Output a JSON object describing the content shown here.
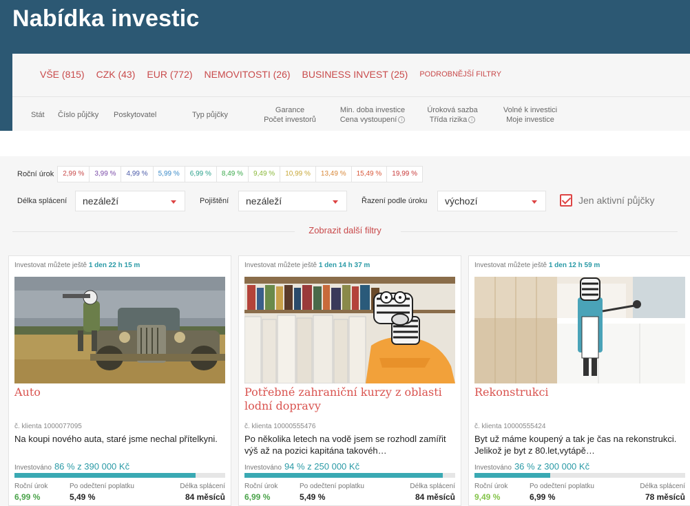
{
  "header": {
    "title": "Nabídka investic"
  },
  "tabs": [
    {
      "label": "VŠE (815)"
    },
    {
      "label": "CZK (43)"
    },
    {
      "label": "EUR (772)"
    },
    {
      "label": "NEMOVITOSTI (26)"
    },
    {
      "label": "BUSINESS INVEST (25)"
    },
    {
      "label": "PODROBNĚJŠÍ FILTRY"
    }
  ],
  "columns": {
    "stat": "Stát",
    "cislo": "Číslo půjčky",
    "poskytovatel": "Poskytovatel",
    "typ": "Typ půjčky",
    "garance": "Garance",
    "pocet": "Počet investorů",
    "min_doba": "Min. doba investice",
    "cena": "Cena vystoupení",
    "urokova": "Úroková sazba",
    "trida": "Třída rizika",
    "volne": "Volné k investici",
    "moje": "Moje investice"
  },
  "rates": {
    "label": "Roční úrok",
    "chips": [
      {
        "label": "2,99 %",
        "color": "#c84a4a"
      },
      {
        "label": "3,99 %",
        "color": "#7a4aa8"
      },
      {
        "label": "4,99 %",
        "color": "#4a5aa8"
      },
      {
        "label": "5,99 %",
        "color": "#3a8ac8"
      },
      {
        "label": "6,99 %",
        "color": "#2aa08a"
      },
      {
        "label": "8,49 %",
        "color": "#3aa84a"
      },
      {
        "label": "9,49 %",
        "color": "#8ab83a"
      },
      {
        "label": "10,99 %",
        "color": "#c8a83a"
      },
      {
        "label": "13,49 %",
        "color": "#d8883a"
      },
      {
        "label": "15,49 %",
        "color": "#d8583a"
      },
      {
        "label": "19,99 %",
        "color": "#c83a3a"
      }
    ]
  },
  "filters": {
    "delka_label": "Délka splácení",
    "delka_value": "nezáleží",
    "pojisteni_label": "Pojištění",
    "pojisteni_value": "nezáleží",
    "razeni_label": "Řazení podle úroku",
    "razeni_value": "výchozí",
    "aktivni_label": "Jen aktivní půjčky",
    "more": "Zobrazit další filtry"
  },
  "cards": [
    {
      "time_prefix": "Investovat můžete ještě",
      "time": "1 den 22 h 15 m",
      "title": "Auto",
      "client": "č. klienta 1000077095",
      "desc": "Na koupi nového auta, staré jsme nechal přítelkyni.",
      "inv_label": "Investováno",
      "inv_value": "86 % z 390 000 Kč",
      "progress": 0.86,
      "rate_label": "Roční úrok",
      "rate": "6,99 %",
      "fee_label": "Po odečtení poplatku",
      "fee": "5,49 %",
      "len_label": "Délka splácení",
      "len": "84 měsíců"
    },
    {
      "time_prefix": "Investovat můžete ještě",
      "time": "1 den 14 h 37 m",
      "title": "Potřebné zahraniční kurzy z oblasti lodní dopravy",
      "client": "č. klienta 10000555476",
      "desc": "Po několika letech na vodě jsem se rozhodl zamířit výš až na pozici kapitána takovéh…",
      "inv_label": "Investováno",
      "inv_value": "94 % z 250 000 Kč",
      "progress": 0.94,
      "rate_label": "Roční úrok",
      "rate": "6,99 %",
      "fee_label": "Po odečtení poplatku",
      "fee": "5,49 %",
      "len_label": "Délka splácení",
      "len": "84 měsíců"
    },
    {
      "time_prefix": "Investovat můžete ještě",
      "time": "1 den 12 h 59 m",
      "title": "Rekonstrukci",
      "client": "č. klienta 10000555424",
      "desc": "Byt už máme koupený a tak je čas na rekonstrukci. Jelikož je byt z 80.let,vytápě…",
      "inv_label": "Investováno",
      "inv_value": "36 % z 300 000 Kč",
      "progress": 0.36,
      "rate_label": "Roční úrok",
      "rate": "9,49 %",
      "fee_label": "Po odečtení poplatku",
      "fee": "6,99 %",
      "len_label": "Délka splácení",
      "len": "78 měsíců"
    }
  ]
}
